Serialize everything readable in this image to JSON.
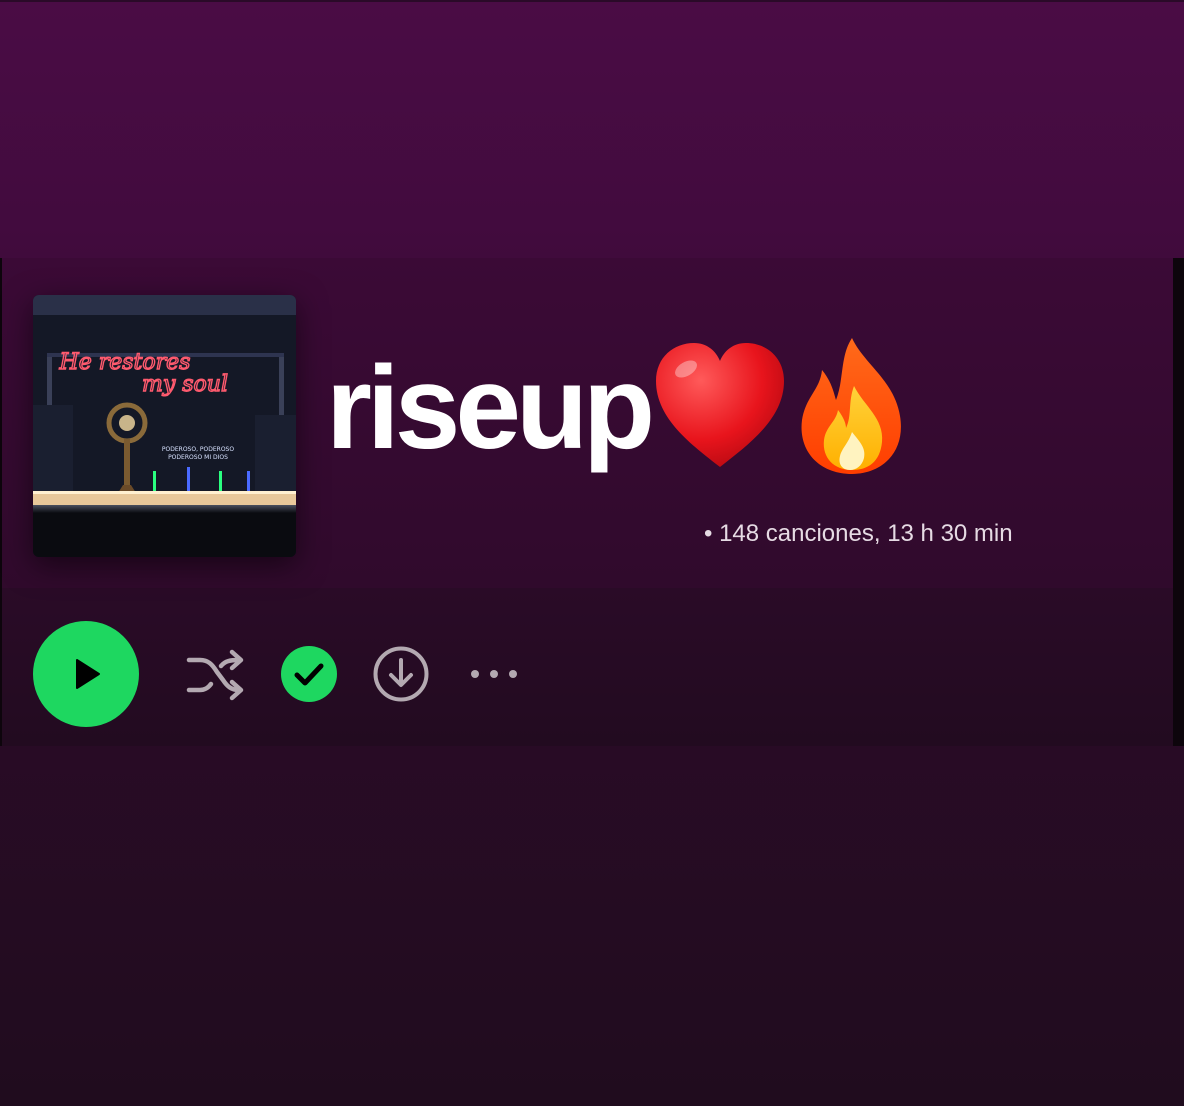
{
  "playlist": {
    "title": "riseup",
    "title_emojis": [
      "heart-emoji",
      "fire-emoji"
    ],
    "meta": "• 148 canciones, 13 h 30 min",
    "cover": {
      "line1": "He restores",
      "line2": "my soul",
      "sign1": "PODEROSO, PODEROSO",
      "sign2": "PODEROSO MI DIOS"
    }
  },
  "controls": {
    "play": "play-icon",
    "shuffle": "shuffle-icon",
    "saved": "check-icon",
    "download": "download-icon",
    "more": "more-icon"
  },
  "colors": {
    "accent": "#1ed760",
    "background_top": "#4a0c45",
    "background_bottom": "#200c1e",
    "title": "#ffffff",
    "meta": "#e6dbe4"
  }
}
